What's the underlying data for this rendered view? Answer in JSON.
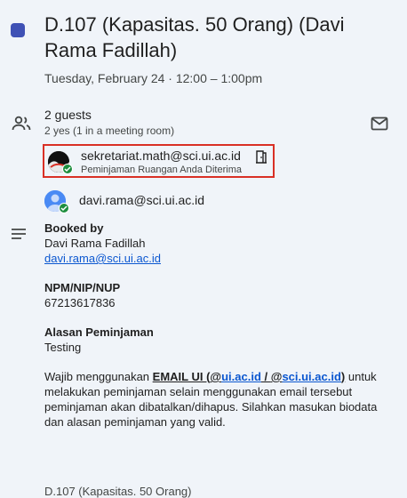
{
  "event": {
    "title": "D.107 (Kapasitas. 50 Orang) (Davi Rama Fadillah)",
    "datetime": "Tuesday, February 24 · 12:00 – 1:00pm",
    "color": "#3f51b5"
  },
  "guests": {
    "count_label": "2 guests",
    "summary": "2 yes (1 in a meeting room)",
    "list": [
      {
        "email": "sekretariat.math@sci.ui.ac.id",
        "note": "Peminjaman Ruangan Anda Diterima",
        "icon": "meeting-room-icon"
      },
      {
        "email": "davi.rama@sci.ui.ac.id"
      }
    ]
  },
  "description": {
    "booked_by_label": "Booked by",
    "booked_by_name": "Davi Rama Fadillah",
    "booked_by_email": "davi.rama@sci.ui.ac.id",
    "npm_label": "NPM/NIP/NUP",
    "npm_value": "67213617836",
    "reason_label": "Alasan Peminjaman",
    "reason_value": "Testing",
    "notice_prefix": "Wajib menggunakan ",
    "notice_email_ui": "EMAIL UI (",
    "notice_at1": "@",
    "notice_domain1": "ui.ac.id",
    "notice_sep": " / ",
    "notice_at2": "@",
    "notice_domain2": "sci.ui.ac.id",
    "notice_close": ")",
    "notice_rest": " untuk melakukan peminjaman selain menggunakan email tersebut peminjaman akan dibatalkan/dihapus. Silahkan masukan biodata dan alasan peminjaman yang valid.",
    "footer_cut": "D.107 (Kapasitas. 50 Orang)"
  }
}
